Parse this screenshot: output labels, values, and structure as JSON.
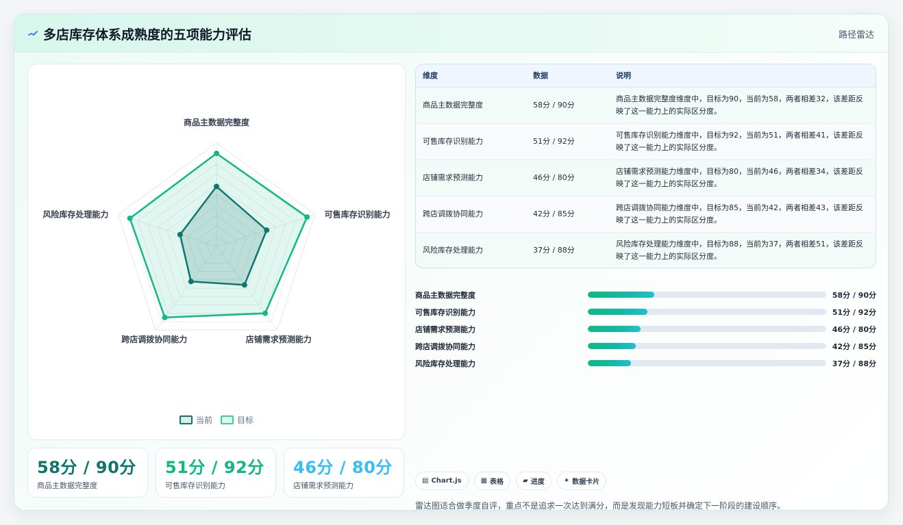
{
  "header": {
    "title": "多店库存体系成熟度的五项能力评估",
    "link": "路径雷达"
  },
  "colors": {
    "current": "#0f766e",
    "target": "#10b981",
    "kpi": [
      "#0f766e",
      "#10b981",
      "#38bdf8"
    ]
  },
  "chart_data": {
    "type": "radar",
    "title": "",
    "axes": [
      "商品主数据完整度",
      "可售库存识别能力",
      "店铺需求预测能力",
      "跨店调拨协同能力",
      "风险库存处理能力"
    ],
    "range": [
      0,
      100
    ],
    "grid_levels": 10,
    "legend_position": "bottom",
    "series": [
      {
        "name": "当前",
        "values": [
          58,
          51,
          46,
          42,
          37
        ]
      },
      {
        "name": "目标",
        "values": [
          90,
          92,
          80,
          85,
          88
        ]
      }
    ]
  },
  "legend": {
    "current": "当前",
    "target": "目标"
  },
  "table": {
    "headers": [
      "维度",
      "数据",
      "说明"
    ],
    "rows": [
      {
        "dim": "商品主数据完整度",
        "value": "58分 / 90分",
        "desc": "商品主数据完整度维度中，目标为90，当前为58，两者相差32，该差距反映了这一能力上的实际区分度。"
      },
      {
        "dim": "可售库存识别能力",
        "value": "51分 / 92分",
        "desc": "可售库存识别能力维度中，目标为92，当前为51，两者相差41，该差距反映了这一能力上的实际区分度。"
      },
      {
        "dim": "店铺需求预测能力",
        "value": "46分 / 80分",
        "desc": "店铺需求预测能力维度中，目标为80，当前为46，两者相差34，该差距反映了这一能力上的实际区分度。"
      },
      {
        "dim": "跨店调拨协同能力",
        "value": "42分 / 85分",
        "desc": "跨店调拨协同能力维度中，目标为85，当前为42，两者相差43，该差距反映了这一能力上的实际区分度。"
      },
      {
        "dim": "风险库存处理能力",
        "value": "37分 / 88分",
        "desc": "风险库存处理能力维度中，目标为88，当前为37，两者相差51，该差距反映了这一能力上的实际区分度。"
      }
    ]
  },
  "progress": [
    {
      "label": "商品主数据完整度",
      "value": "58分 / 90分",
      "percent": 28
    },
    {
      "label": "可售库存识别能力",
      "value": "51分 / 92分",
      "percent": 25
    },
    {
      "label": "店铺需求预测能力",
      "value": "46分 / 80分",
      "percent": 22
    },
    {
      "label": "跨店调拨协同能力",
      "value": "42分 / 85分",
      "percent": 20
    },
    {
      "label": "风险库存处理能力",
      "value": "37分 / 88分",
      "percent": 18
    }
  ],
  "kpis": [
    {
      "value": "58分 / 90分",
      "label": "商品主数据完整度"
    },
    {
      "value": "51分 / 92分",
      "label": "可售库存识别能力"
    },
    {
      "value": "46分 / 80分",
      "label": "店铺需求预测能力"
    }
  ],
  "chips": [
    {
      "icon": "chart-icon",
      "glyph": "▤",
      "label": "Chart.js"
    },
    {
      "icon": "table-icon",
      "glyph": "▦",
      "label": "表格"
    },
    {
      "icon": "progress-icon",
      "glyph": "▰",
      "label": "进度"
    },
    {
      "icon": "card-icon",
      "glyph": "✦",
      "label": "数据卡片"
    }
  ],
  "footnote": "雷达图适合做季度自评，重点不是追求一次达到满分，而是发现能力短板并确定下一阶段的建设顺序。"
}
